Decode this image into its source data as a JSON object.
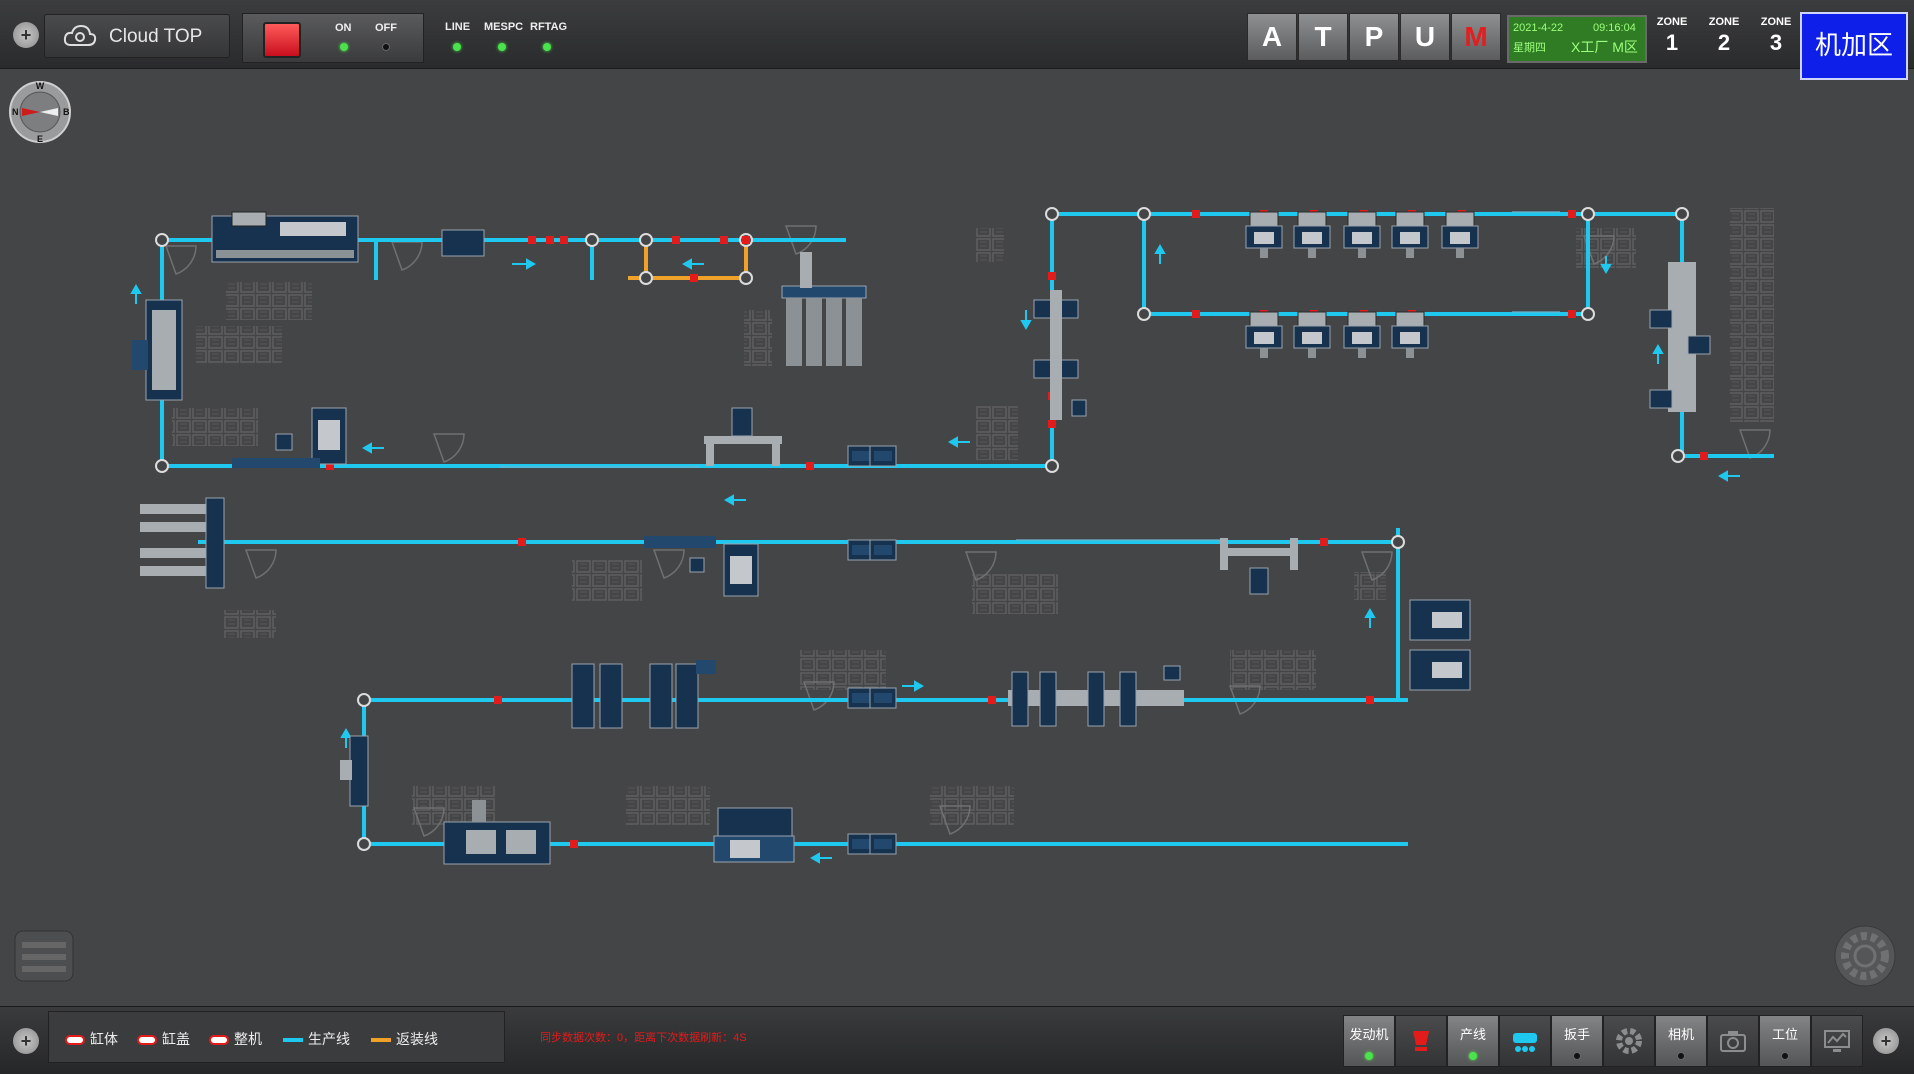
{
  "header": {
    "brand_name": "Cloud TOP",
    "power": {
      "on_label": "ON",
      "off_label": "OFF"
    },
    "indicators": [
      {
        "label": "LINE",
        "state": "on"
      },
      {
        "label": "MESPC",
        "state": "on"
      },
      {
        "label": "RFTAG",
        "state": "on"
      }
    ],
    "modes": [
      {
        "label": "A",
        "color": "#ffffff"
      },
      {
        "label": "T",
        "color": "#ffffff"
      },
      {
        "label": "P",
        "color": "#ffffff"
      },
      {
        "label": "U",
        "color": "#ffffff"
      },
      {
        "label": "M",
        "color": "#e41e1e"
      }
    ],
    "clock": {
      "date": "2021-4-22",
      "time": "09:16:04",
      "weekday": "星期四",
      "location": "X工厂 M区"
    },
    "zones": [
      {
        "label": "ZONE",
        "number": "1"
      },
      {
        "label": "ZONE",
        "number": "2"
      },
      {
        "label": "ZONE",
        "number": "3"
      }
    ],
    "area_button": "机加区"
  },
  "compass": {
    "north": "W",
    "west": "N",
    "east": "B",
    "south": "E"
  },
  "legend": [
    {
      "label": "缸体",
      "type": "pill",
      "color": "#e31b1b"
    },
    {
      "label": "缸盖",
      "type": "pill",
      "color": "#e31b1b"
    },
    {
      "label": "整机",
      "type": "pill",
      "color": "#e31b1b"
    },
    {
      "label": "生产线",
      "type": "line",
      "color": "#1ec8ef"
    },
    {
      "label": "返装线",
      "type": "line",
      "color": "#f0a12a"
    }
  ],
  "status_message": "同步数据次数：0，距离下次数据刷新：4S",
  "toolbar": [
    {
      "label": "发动机",
      "icon": "engine-icon",
      "led": "on"
    },
    {
      "label": "",
      "icon": "cup-icon",
      "led": ""
    },
    {
      "label": "产线",
      "icon": "line-icon",
      "led": "on"
    },
    {
      "label": "",
      "icon": "conveyor-icon",
      "led": ""
    },
    {
      "label": "扳手",
      "icon": "wrench-icon",
      "led": "off"
    },
    {
      "label": "",
      "icon": "gear-icon",
      "led": ""
    },
    {
      "label": "相机",
      "icon": "camera-icon",
      "led": "off"
    },
    {
      "label": "",
      "icon": "camera-icon",
      "led": ""
    },
    {
      "label": "工位",
      "icon": "station-icon",
      "led": "off"
    },
    {
      "label": "",
      "icon": "monitor-icon",
      "led": ""
    }
  ],
  "colors": {
    "production_line": "#1ec8ef",
    "return_line": "#f0a12a",
    "stopper": "#e31b1b",
    "machine": "#17324f",
    "background": "#444546"
  }
}
